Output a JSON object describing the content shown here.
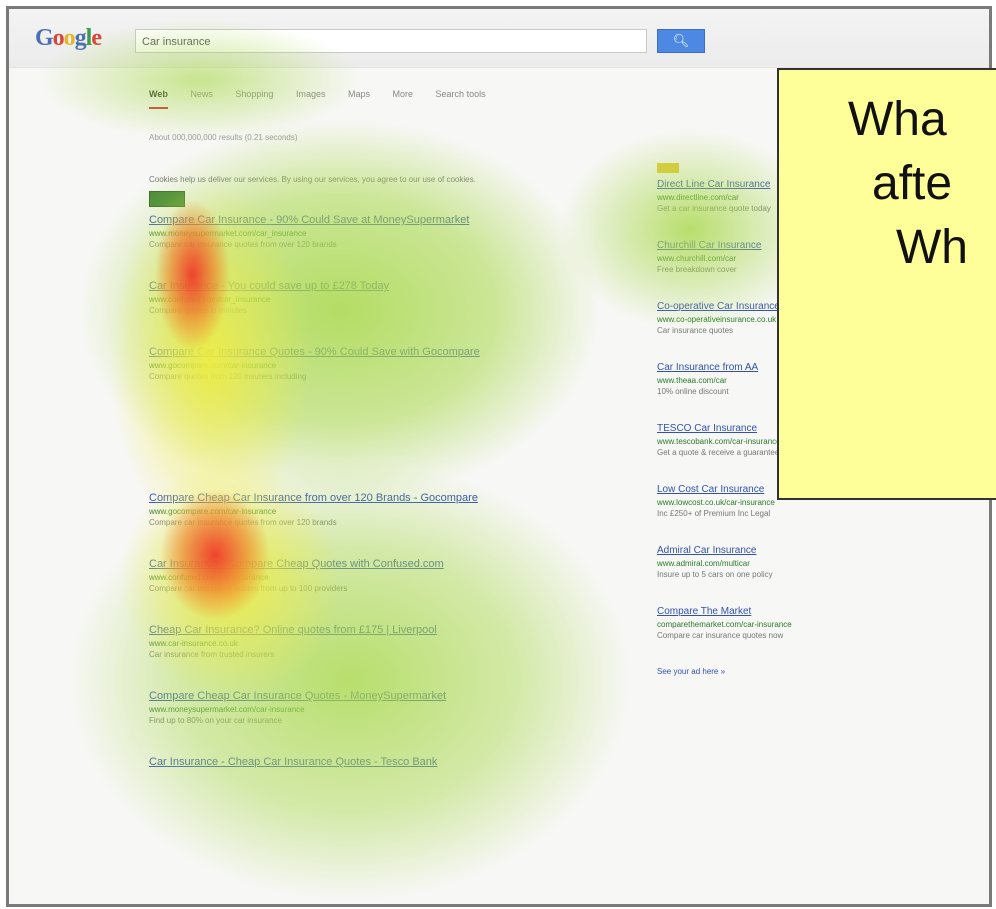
{
  "google": {
    "logo_letters": [
      "G",
      "o",
      "o",
      "g",
      "l",
      "e"
    ],
    "search_value": "Car insurance",
    "search_button_icon": "magnifier-icon",
    "tabs": [
      "Web",
      "News",
      "Shopping",
      "Images",
      "Maps",
      "More",
      "Search tools"
    ],
    "stats": "About 000,000,000 results (0.21 seconds)",
    "cookie_notice": "Cookies help us deliver our services. By using our services, you agree to our use of cookies.",
    "results": [
      {
        "title": "Compare Car Insurance - 90% Could Save at MoneySupermarket",
        "url": "www.moneysupermarket.com/car_insurance",
        "snippet": "Compare car insurance quotes from over 120 brands"
      },
      {
        "title": "Car Insurance - You could save up to £278 Today",
        "url": "www.confused.com/car_insurance",
        "snippet": "Compare quotes in minutes"
      },
      {
        "title": "Compare Car Insurance Quotes - 90% Could Save with Gocompare",
        "url": "www.gocompare.com/car-insurance",
        "snippet": "Compare quotes from 120 insurers including"
      },
      {
        "title": "Compare Cheap Car Insurance from over 120 Brands - Gocompare",
        "url": "www.gocompare.com/car-insurance",
        "snippet": "Compare car insurance quotes from over 120 brands"
      },
      {
        "title": "Car Insurance - Compare Cheap Quotes with Confused.com",
        "url": "www.confused.com/car-insurance",
        "snippet": "Compare car insurance quotes from up to 100 providers"
      },
      {
        "title": "Cheap Car Insurance? Online quotes from £175 | Liverpool",
        "url": "www.car-insurance.co.uk",
        "snippet": "Car insurance from trusted insurers"
      },
      {
        "title": "Compare Cheap Car Insurance Quotes - MoneySupermarket",
        "url": "www.moneysupermarket.com/car-insurance",
        "snippet": "Find up to 80% on your car insurance"
      },
      {
        "title": "Car Insurance - Cheap Car Insurance Quotes - Tesco Bank",
        "url": "",
        "snippet": ""
      }
    ],
    "ads": [
      {
        "title": "Direct Line Car Insurance",
        "url": "www.directline.com/car",
        "snippet": "Get a car insurance quote today"
      },
      {
        "title": "Churchill Car Insurance",
        "url": "www.churchill.com/car",
        "snippet": "Free breakdown cover"
      },
      {
        "title": "Co-operative Car Insurance",
        "url": "www.co-operativeinsurance.co.uk",
        "snippet": "Car insurance quotes"
      },
      {
        "title": "Car Insurance from AA",
        "url": "www.theaa.com/car",
        "snippet": "10% online discount"
      },
      {
        "title": "TESCO Car Insurance",
        "url": "www.tescobank.com/car-insurance",
        "snippet": "Get a quote & receive a guaranteed discount"
      },
      {
        "title": "Low Cost Car Insurance",
        "url": "www.lowcost.co.uk/car-insurance",
        "snippet": "Inc £250+ of Premium Inc Legal"
      },
      {
        "title": "Admiral Car Insurance",
        "url": "www.admiral.com/multicar",
        "snippet": "Insure up to 5 cars on one policy"
      },
      {
        "title": "Compare The Market",
        "url": "comparethemarket.com/car-insurance",
        "snippet": "Compare car insurance quotes now"
      }
    ],
    "more_ads": "See your ad here »"
  },
  "callout": {
    "lines": [
      "Wha",
      "afte",
      "Wh"
    ]
  },
  "colors": {
    "frame_border": "#7a7a7a",
    "callout_bg": "#ffff99",
    "heat_green": "#a8d84a",
    "heat_yellow": "#f0ec40",
    "heat_red": "#f03a2a"
  }
}
